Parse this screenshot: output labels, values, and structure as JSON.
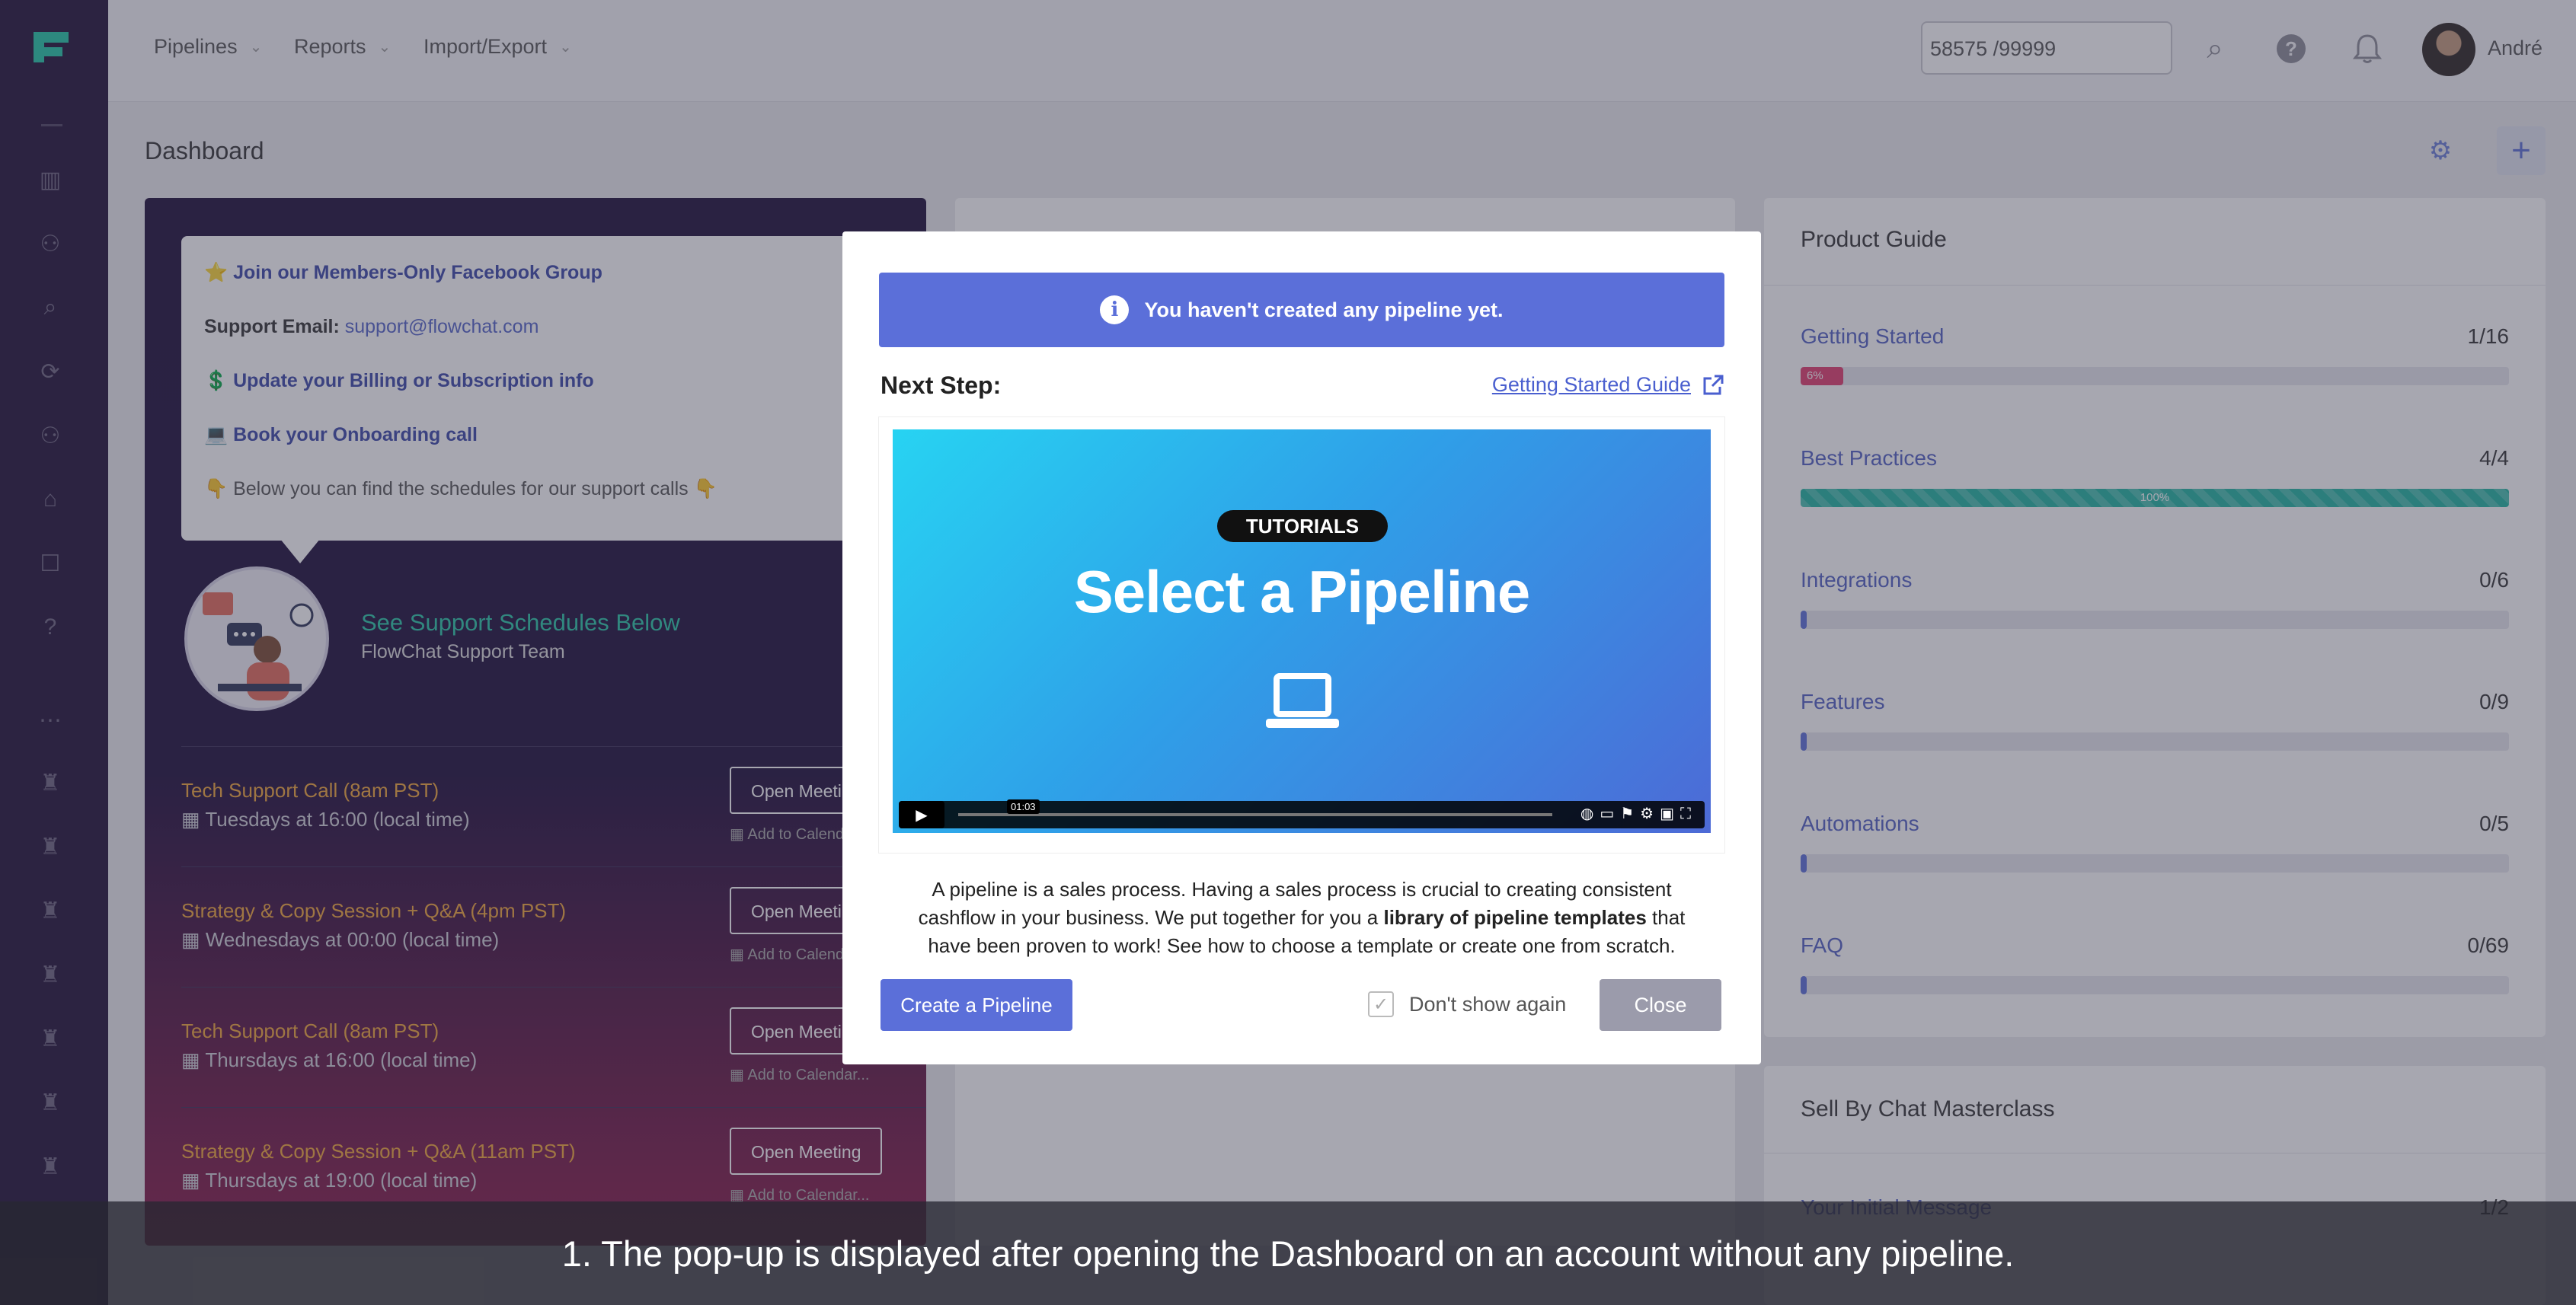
{
  "topbar": {
    "nav": [
      "Pipelines",
      "Reports",
      "Import/Export"
    ],
    "counter": "58575 /99999",
    "username": "André"
  },
  "page": {
    "title": "Dashboard"
  },
  "support": {
    "facebook": "⭐ Join our Members-Only Facebook Group",
    "email_label": "Support Email:",
    "email": "support@flowchat.com",
    "billing": "💲 Update your Billing or Subscription info",
    "onboarding": "💻 Book your Onboarding call",
    "schedules_note": "👇 Below you can find the schedules for our support calls 👇",
    "heading": "See Support Schedules Below",
    "team": "FlowChat Support Team",
    "schedules": [
      {
        "name": "Tech Support Call (8am PST)",
        "when": "Tuesdays at 16:00 (local time)",
        "button": "Open Meeting",
        "calendar": "Add to Calendar..."
      },
      {
        "name": "Strategy & Copy Session + Q&A (4pm PST)",
        "when": "Wednesdays at 00:00 (local time)",
        "button": "Open Meeting",
        "calendar": "Add to Calendar..."
      },
      {
        "name": "Tech Support Call (8am PST)",
        "when": "Thursdays at 16:00 (local time)",
        "button": "Open Meeting",
        "calendar": "Add to Calendar..."
      },
      {
        "name": "Strategy & Copy Session + Q&A (11am PST)",
        "when": "Thursdays at 19:00 (local time)",
        "button": "Open Meeting",
        "calendar": "Add to Calendar..."
      }
    ]
  },
  "guide": {
    "title": "Product Guide",
    "items": [
      {
        "label": "Getting Started",
        "count": "1/16",
        "progress": 6,
        "progress_label": "6%",
        "color": "#e23c6e"
      },
      {
        "label": "Best Practices",
        "count": "4/4",
        "progress": 100,
        "progress_label": "100%",
        "color": "#1fb5a0"
      },
      {
        "label": "Integrations",
        "count": "0/6",
        "progress": 0,
        "progress_label": "",
        "color": "#5b6fd9"
      },
      {
        "label": "Features",
        "count": "0/9",
        "progress": 0,
        "progress_label": "",
        "color": "#5b6fd9"
      },
      {
        "label": "Automations",
        "count": "0/5",
        "progress": 0,
        "progress_label": "",
        "color": "#5b6fd9"
      },
      {
        "label": "FAQ",
        "count": "0/69",
        "progress": 0,
        "progress_label": "",
        "color": "#5b6fd9"
      }
    ]
  },
  "masterclass": {
    "title": "Sell By Chat Masterclass",
    "item": "Your Initial Message",
    "count": "1/2"
  },
  "modal": {
    "alert": "You haven't created any pipeline yet.",
    "next_step": "Next Step:",
    "guide_link": "Getting Started Guide",
    "video": {
      "badge": "TUTORIALS",
      "title": "Select a Pipeline",
      "time": "01:03"
    },
    "desc_part1": "A pipeline is a sales process. Having a sales process is crucial to creating consistent cashflow in your business. We put together for you a ",
    "desc_bold": "library of pipeline templates",
    "desc_part2": " that have been proven to work! See how to choose a template or create one from scratch.",
    "create_button": "Create a Pipeline",
    "dont_show": "Don't show again",
    "close_button": "Close"
  },
  "caption": "1. The pop-up is displayed after opening the Dashboard on an account without any pipeline.",
  "colors": {
    "accent": "#5b6fd9",
    "sidebar": "#1f0f35",
    "teal": "#28c6a6"
  }
}
